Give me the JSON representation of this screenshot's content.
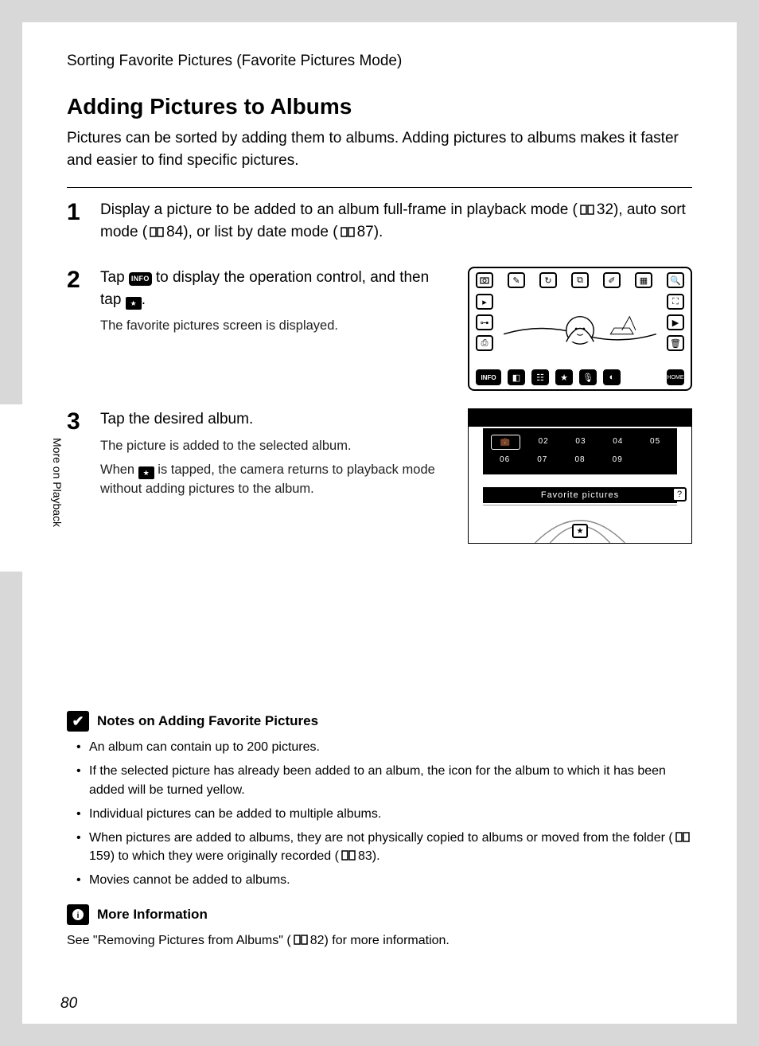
{
  "section_header": "Sorting Favorite Pictures (Favorite Pictures Mode)",
  "title": "Adding Pictures to Albums",
  "intro": "Pictures can be sorted by adding them to albums. Adding pictures to albums makes it faster and easier to find specific pictures.",
  "side_label": "More on Playback",
  "page_number": "80",
  "steps": {
    "s1": {
      "num": "1",
      "text_a": "Display a picture to be added to an album full-frame in playback mode (",
      "ref1": "32",
      "text_b": "), auto sort mode (",
      "ref2": "84",
      "text_c": "), or list by date mode (",
      "ref3": "87",
      "text_d": ")."
    },
    "s2": {
      "num": "2",
      "text_a": "Tap ",
      "info_label": "INFO",
      "text_b": " to display the operation control, and then tap ",
      "text_c": ".",
      "sub": "The favorite pictures screen is displayed."
    },
    "s3": {
      "num": "3",
      "main": "Tap the desired album.",
      "sub1": "The picture is added to the selected album.",
      "sub2_a": "When ",
      "sub2_b": " is tapped, the camera returns to playback mode without adding pictures to the album."
    }
  },
  "illus2": {
    "row1": [
      "",
      "02",
      "03",
      "04",
      "05"
    ],
    "row2": [
      "06",
      "07",
      "08",
      "09",
      ""
    ],
    "caption": "Favorite pictures",
    "help": "?"
  },
  "notes": {
    "icon": "✔",
    "title": "Notes on Adding Favorite Pictures",
    "items": [
      "An album can contain up to 200 pictures.",
      "If the selected picture has already been added to an album, the icon for the album to which it has been added will be turned yellow.",
      "Individual pictures can be added to multiple albums.",
      {
        "pre": "When pictures are added to albums, they are not physically copied to albums or moved from the folder (",
        "ref1": "159",
        "mid": ") to which they were originally recorded (",
        "ref2": "83",
        "post": ")."
      },
      "Movies cannot be added to albums."
    ]
  },
  "more_info": {
    "icon_label": "i",
    "title": "More Information",
    "text_a": "See \"Removing Pictures from Albums\" (",
    "ref": "82",
    "text_b": ") for more information."
  }
}
